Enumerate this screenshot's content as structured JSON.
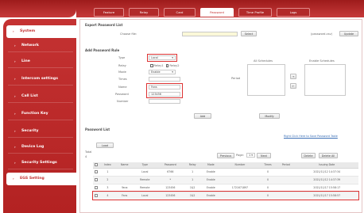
{
  "colors": {
    "brand": "#c43232",
    "highlight": "#dd3333",
    "link": "#3b6fb6"
  },
  "tabs": [
    "Feature",
    "Relay",
    "Card",
    "Password",
    "Time Profile",
    "Logs"
  ],
  "active_tab": "Password",
  "sidebar": {
    "items": [
      {
        "label": "System",
        "active": true
      },
      {
        "label": "Network"
      },
      {
        "label": "Line"
      },
      {
        "label": "Intercom settings"
      },
      {
        "label": "Call List"
      },
      {
        "label": "Function Key"
      },
      {
        "label": "Security"
      },
      {
        "label": "Device Log"
      },
      {
        "label": "Security Settings"
      },
      {
        "label": "EGS Setting",
        "selected": true
      }
    ]
  },
  "export": {
    "title": "Export Password List",
    "choose_file_label": "Choose file:",
    "select_button": "Select",
    "file_hint": "(password.csv)",
    "upload_button": "Update"
  },
  "add": {
    "title": "Add Password Rule",
    "type_label": "Type",
    "type_value": "Local",
    "relay_label": "Relay",
    "relay1": "Relay1",
    "relay2": "Relay2",
    "mode_label": "Mode",
    "mode_value": "Enable",
    "times_label": "Times",
    "name_label": "Name",
    "name_value": "Fans",
    "password_label": "Password",
    "password_value": "123456",
    "number_label": "Number",
    "period_label": "Period",
    "all_schedules": "All Schedules",
    "enable_schedules": "Enable Schedules",
    "move_right": "→",
    "move_left": "←",
    "add_button": "Add",
    "modify_button": "Modify"
  },
  "list": {
    "title": "Password List",
    "load_button": "Load",
    "import_link": "Right Click Here to Save Password Table",
    "total_label": "Total",
    "total_value": "4",
    "previous": "Previous",
    "page_label": "Page:",
    "page_value": "1 ▾",
    "next": "Next",
    "delete": "Delete",
    "delete_all": "Delete All",
    "headers": [
      "Index",
      "Name",
      "Type",
      "Password",
      "Relay",
      "Mode",
      "Number",
      "Times",
      "Period",
      "Issuing Date"
    ],
    "rows": [
      [
        "1",
        "",
        "Local",
        "6766",
        "1",
        "Enable",
        "",
        "0",
        "",
        "2021/11/12 14:37:34"
      ],
      [
        "2",
        "",
        "Remote",
        "*",
        "1",
        "Enable",
        "",
        "0",
        "",
        "2021/11/12 14:37:39"
      ],
      [
        "3",
        "Yana",
        "Remote",
        "123456",
        "1&2",
        "Enable",
        "1721671897",
        "0",
        "",
        "2021/11/17 15:58:17"
      ],
      [
        "4",
        "Fans",
        "Local",
        "123456",
        "1&2",
        "Enable",
        "",
        "0",
        "",
        "2021/11/17 15:58:57"
      ]
    ]
  }
}
